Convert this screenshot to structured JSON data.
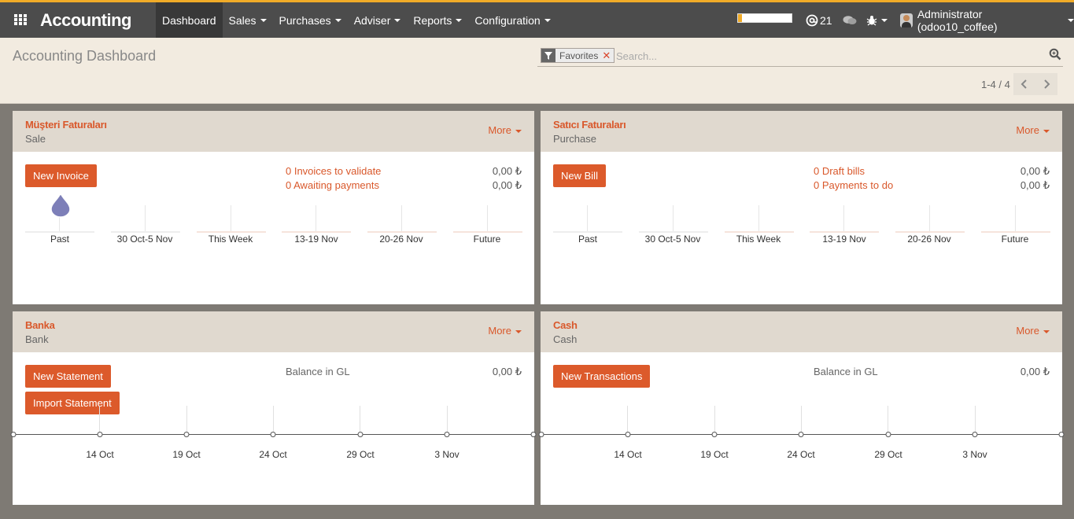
{
  "app": {
    "title": "Accounting"
  },
  "menu": [
    {
      "label": "Dashboard",
      "dropdown": false
    },
    {
      "label": "Sales",
      "dropdown": true
    },
    {
      "label": "Purchases",
      "dropdown": true
    },
    {
      "label": "Adviser",
      "dropdown": true
    },
    {
      "label": "Reports",
      "dropdown": true
    },
    {
      "label": "Configuration",
      "dropdown": true
    }
  ],
  "systray": {
    "progress": 0.07,
    "mentions": "21",
    "user": "Administrator (odoo10_coffee)"
  },
  "control_panel": {
    "title": "Accounting Dashboard",
    "facet": "Favorites",
    "search_placeholder": "Search...",
    "pager": "1-4 / 4"
  },
  "colors": {
    "accent": "#dc5a2b",
    "brand_bar": "#f0ab28",
    "topbar": "#4c4c4c"
  },
  "journals": [
    {
      "title": "Müşteri Faturaları",
      "type": "Sale",
      "more": "More",
      "buttons": [
        "New Invoice"
      ],
      "lines": [
        {
          "label": "0 Invoices to validate",
          "amount": "0,00 ₺"
        },
        {
          "label": "0 Awaiting payments",
          "amount": "0,00 ₺"
        }
      ],
      "chart_ticks": [
        "Past",
        "30 Oct-5 Nov",
        "This Week",
        "13-19 Nov",
        "20-26 Nov",
        "Future"
      ]
    },
    {
      "title": "Satıcı Faturaları",
      "type": "Purchase",
      "more": "More",
      "buttons": [
        "New Bill"
      ],
      "lines": [
        {
          "label": "0 Draft bills",
          "amount": "0,00 ₺"
        },
        {
          "label": "0 Payments to do",
          "amount": "0,00 ₺"
        }
      ],
      "chart_ticks": [
        "Past",
        "30 Oct-5 Nov",
        "This Week",
        "13-19 Nov",
        "20-26 Nov",
        "Future"
      ]
    },
    {
      "title": "Banka",
      "type": "Bank",
      "more": "More",
      "buttons": [
        "New Statement",
        "Import Statement"
      ],
      "balance_label": "Balance in GL",
      "balance": "0,00 ₺",
      "chart_ticks": [
        "14 Oct",
        "19 Oct",
        "24 Oct",
        "29 Oct",
        "3 Nov"
      ]
    },
    {
      "title": "Cash",
      "type": "Cash",
      "more": "More",
      "buttons": [
        "New Transactions"
      ],
      "balance_label": "Balance in GL",
      "balance": "0,00 ₺",
      "chart_ticks": [
        "14 Oct",
        "19 Oct",
        "24 Oct",
        "29 Oct",
        "3 Nov"
      ]
    }
  ]
}
